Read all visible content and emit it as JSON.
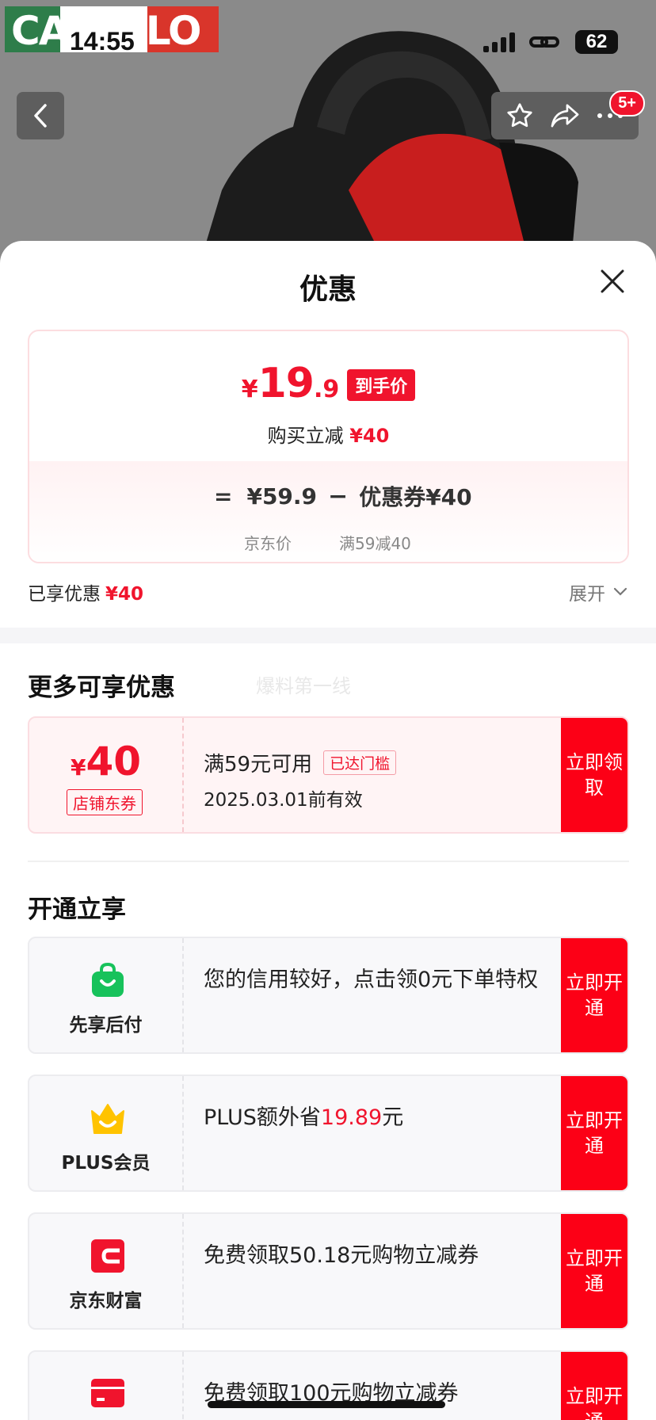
{
  "status_bar": {
    "time": "14:55",
    "battery": "62"
  },
  "watermark_logo": "CARTELO",
  "top_badge": "5+",
  "sheet": {
    "title": "优惠",
    "price": {
      "currency": "¥",
      "integer": "19",
      "decimal": ".9",
      "tag": "到手价",
      "instant_cut_label": "购买立减",
      "instant_cut_value": "¥40"
    },
    "breakdown": {
      "eq": "=",
      "jd_price": "¥59.9",
      "minus": "−",
      "coupon_label": "优惠券¥40",
      "jd_price_label": "京东价",
      "coupon_rule": "满59减40"
    },
    "enjoyed_label": "已享优惠",
    "enjoyed_value": "¥40",
    "expand_label": "展开"
  },
  "more_discounts": {
    "title": "更多可享优惠",
    "watermark": "爆料第一线",
    "coupon": {
      "currency": "¥",
      "amount": "40",
      "type": "店铺东券",
      "condition": "满59元可用",
      "reached": "已达门槛",
      "validity": "2025.03.01前有效",
      "button": "立即领取"
    }
  },
  "open_section": {
    "title": "开通立享",
    "items": [
      {
        "icon": "shopping-bag-icon",
        "name": "先享后付",
        "text": "您的信用较好，点击领0元下单特权",
        "button": "立即开通"
      },
      {
        "icon": "crown-icon",
        "name": "PLUS会员",
        "text_before": "PLUS额外省",
        "highlight": "19.89",
        "text_after": "元",
        "button": "立即开通"
      },
      {
        "icon": "wallet-icon",
        "name": "京东财富",
        "text": "免费领取50.18元购物立减券",
        "button": "立即开通"
      },
      {
        "icon": "card-icon",
        "name": "",
        "text": "免费领取100元购物立减券",
        "button": "立即开通"
      }
    ]
  },
  "colors": {
    "accent": "#f0142d",
    "button": "#fc0016",
    "green": "#17c25b",
    "gold": "#ffc300"
  }
}
